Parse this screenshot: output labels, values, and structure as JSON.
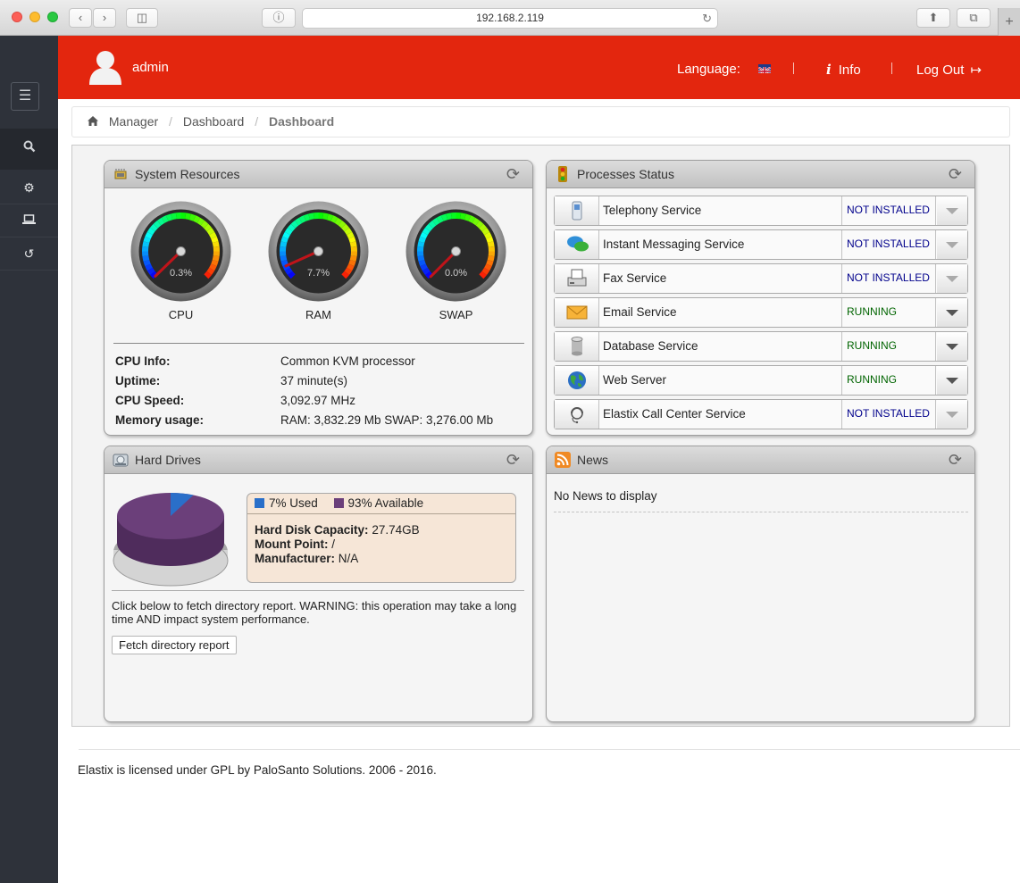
{
  "browser": {
    "url": "192.168.2.119"
  },
  "header": {
    "username": "admin",
    "language_label": "Language:",
    "info_label": "Info",
    "logout_label": "Log Out"
  },
  "breadcrumb": {
    "items": [
      "Manager",
      "Dashboard"
    ],
    "current": "Dashboard"
  },
  "system_resources": {
    "title": "System Resources",
    "gauges": [
      {
        "label": "CPU",
        "value_text": "0.3%",
        "value": 0.3
      },
      {
        "label": "RAM",
        "value_text": "7.7%",
        "value": 7.7
      },
      {
        "label": "SWAP",
        "value_text": "0.0%",
        "value": 0.0
      }
    ],
    "info": [
      {
        "key": "CPU Info:",
        "value": "Common KVM processor"
      },
      {
        "key": "Uptime:",
        "value": "37 minute(s)"
      },
      {
        "key": "CPU Speed:",
        "value": "3,092.97 MHz"
      },
      {
        "key": "Memory usage:",
        "value": "RAM: 3,832.29 Mb SWAP: 3,276.00 Mb"
      }
    ]
  },
  "processes": {
    "title": "Processes Status",
    "items": [
      {
        "name": "Telephony Service",
        "status": "NOT INSTALLED",
        "icon": "phone-icon"
      },
      {
        "name": "Instant Messaging Service",
        "status": "NOT INSTALLED",
        "icon": "chat-bubble-icon"
      },
      {
        "name": "Fax Service",
        "status": "NOT INSTALLED",
        "icon": "fax-icon"
      },
      {
        "name": "Email Service",
        "status": "RUNNING",
        "icon": "envelope-icon"
      },
      {
        "name": "Database Service",
        "status": "RUNNING",
        "icon": "database-icon"
      },
      {
        "name": "Web Server",
        "status": "RUNNING",
        "icon": "globe-icon"
      },
      {
        "name": "Elastix Call Center Service",
        "status": "NOT INSTALLED",
        "icon": "headset-icon"
      }
    ],
    "status_colors": {
      "NOT INSTALLED": "#00008b",
      "RUNNING": "#006400"
    }
  },
  "hard_drives": {
    "title": "Hard Drives",
    "used_label": "7% Used",
    "available_label": "93% Available",
    "used_fraction": 0.07,
    "used_color": "#2a6fc9",
    "available_color": "#6b3f7a",
    "capacity_key": "Hard Disk Capacity:",
    "capacity_value": "27.74GB",
    "mount_key": "Mount Point:",
    "mount_value": "/",
    "manufacturer_key": "Manufacturer:",
    "manufacturer_value": "N/A",
    "warning": "Click below to fetch directory report. WARNING: this operation may take a long time AND impact system performance.",
    "fetch_button": "Fetch directory report"
  },
  "news": {
    "title": "News",
    "empty_text": "No News to display"
  },
  "footer": {
    "text": "Elastix is licensed under GPL by PaloSanto Solutions. 2006 - 2016."
  },
  "colors": {
    "header_red": "#e3260e",
    "sidebar": "#2e323a"
  }
}
